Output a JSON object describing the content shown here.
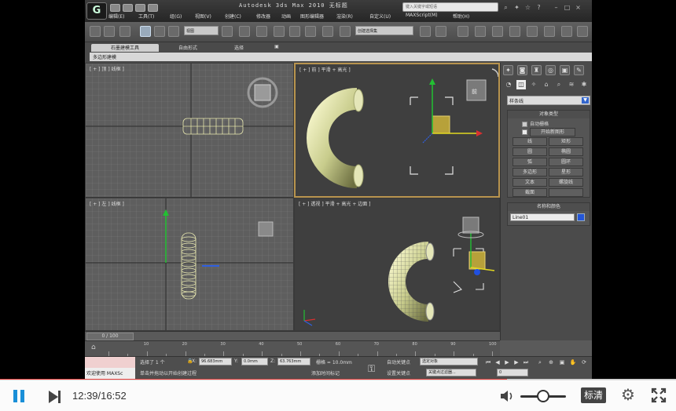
{
  "app": {
    "title": "Autodesk 3ds Max   2010     无标题",
    "logo": "G",
    "search_placeholder": "键入关键字或短语",
    "menu": [
      "编辑(E)",
      "工具(T)",
      "组(G)",
      "视图(V)",
      "创建(C)",
      "修改器",
      "动画",
      "图形编辑器",
      "渲染(R)",
      "自定义(U)",
      "MAXScript(M)",
      "帮助(H)"
    ]
  },
  "toolbar": {
    "selection_filter": "全部",
    "view_dropdown": "视图",
    "named_selection": "创建选择集"
  },
  "ribbon": {
    "tabs": [
      "石墨建模工具",
      "自由形式",
      "选择",
      "▣"
    ],
    "strip_label": "多边形建模"
  },
  "viewports": {
    "top": "[ + ] 顶 ] 线框 ]",
    "front": "[ + ] 前 ] 平滑 + 高光 ]",
    "left": "[ + ] 左 ] 线框 ]",
    "perspective": "[ + ] 透视 ] 平滑 + 高光 + 边面 ]",
    "viewcube_front": "前",
    "viewcube_top": "顶"
  },
  "command_panel": {
    "category_dropdown": "样条线",
    "object_type_header": "对象类型",
    "auto_grid": "自动栅格",
    "start_new_shape": "开始新图形",
    "buttons": [
      "线",
      "矩形",
      "圆",
      "椭圆",
      "弧",
      "圆环",
      "多边形",
      "星形",
      "文本",
      "螺旋线",
      "截面",
      ""
    ],
    "name_color_header": "名称和颜色",
    "object_name": "Line01",
    "object_color": "#2456d8"
  },
  "timeline": {
    "position": "0 / 100",
    "ticks": [
      "10",
      "20",
      "30",
      "40",
      "50",
      "60",
      "70",
      "80",
      "90",
      "100"
    ]
  },
  "status": {
    "maxscript_label": "欢迎使用 MAXSc",
    "selected": "选择了 1 个",
    "x_label": "X:",
    "x_value": "96.683mm",
    "y_label": "Y:",
    "y_value": "0.0mm",
    "z_label": "Z:",
    "z_value": "63.763mm",
    "grid": "栅格 = 10.0mm",
    "prompt": "单击并拖动以开始创建过程",
    "add_time_tag": "添加时间标记",
    "auto_key": "自动关键点",
    "selected_object": "选定对象",
    "set_key": "设置关键点",
    "key_filters": "关键点过滤器...",
    "frame": "0"
  },
  "player": {
    "current_time": "12:39",
    "total_time": "16:52",
    "time_display": "12:39/16:52",
    "progress": 0.75,
    "volume": 0.4,
    "quality_label": "标清",
    "accent": "#1a8fd8",
    "progress_color": "#e8423f"
  }
}
